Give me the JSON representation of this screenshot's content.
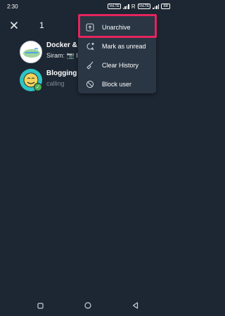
{
  "status_bar": {
    "time": "2:30",
    "chip1": "VoLTE",
    "r_label": "R",
    "chip2": "VoLTE",
    "battery": "88"
  },
  "selection": {
    "count": "1"
  },
  "chats": [
    {
      "name": "Docker & K",
      "preview": "Siram: 📷 I"
    },
    {
      "name": "Blogging G",
      "preview": "calling"
    }
  ],
  "menu": {
    "items": [
      {
        "label": "Unarchive",
        "icon": "unarchive-icon"
      },
      {
        "label": "Mark as unread",
        "icon": "mark-unread-icon"
      },
      {
        "label": "Clear History",
        "icon": "broom-icon"
      },
      {
        "label": "Block user",
        "icon": "block-icon"
      }
    ]
  },
  "colors": {
    "background": "#1d2733",
    "menu_bg": "#2a3644",
    "highlight": "#e5245d",
    "check": "#4cb050"
  }
}
